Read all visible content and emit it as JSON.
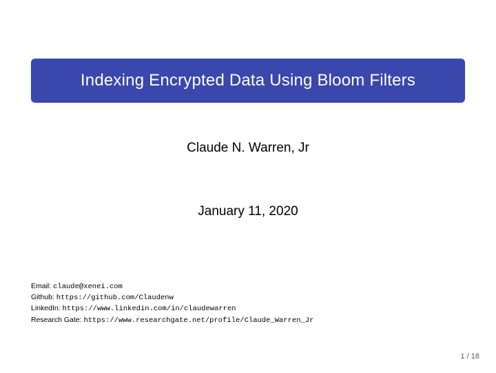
{
  "title": "Indexing Encrypted Data Using Bloom Filters",
  "author": "Claude N. Warren, Jr",
  "date": "January 11, 2020",
  "contacts": {
    "email_label": "Email: ",
    "email_value": "claude@xenei.com",
    "github_label": "Github: ",
    "github_value": "https://github.com/Claudenw",
    "linkedin_label": "LinkedIn: ",
    "linkedin_value": "https://www.linkedin.com/in/claudewarren",
    "researchgate_label": "Research Gate: ",
    "researchgate_value": "https://www.researchgate.net/profile/Claude_Warren_Jr"
  },
  "page": "1 / 18"
}
